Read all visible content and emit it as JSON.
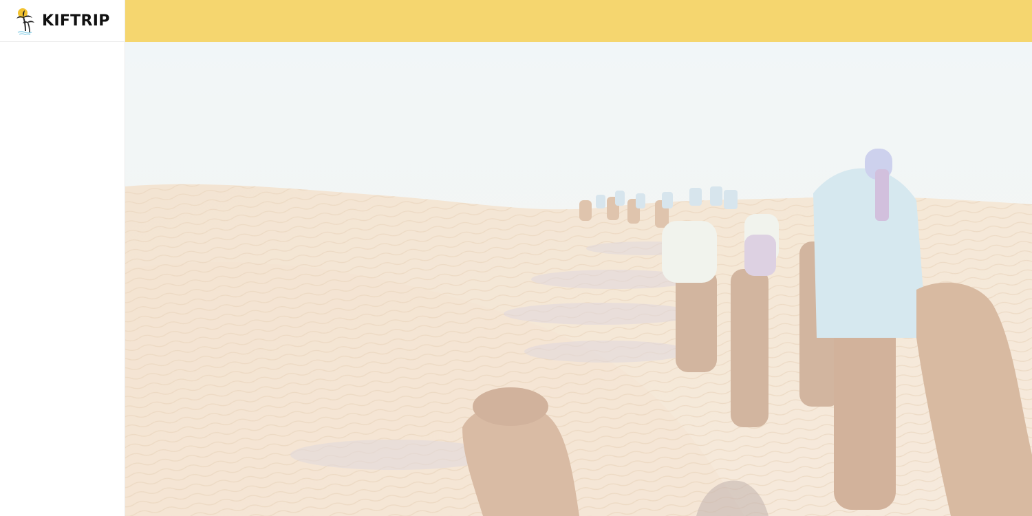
{
  "brand": {
    "name": "KIFTRIP",
    "logo_icon": "palm-tree-sun-icon"
  },
  "topbar": {
    "color": "#f5d66f"
  },
  "hero": {
    "image": "desert-camel-caravan-photo",
    "overlay": "light-washed"
  }
}
